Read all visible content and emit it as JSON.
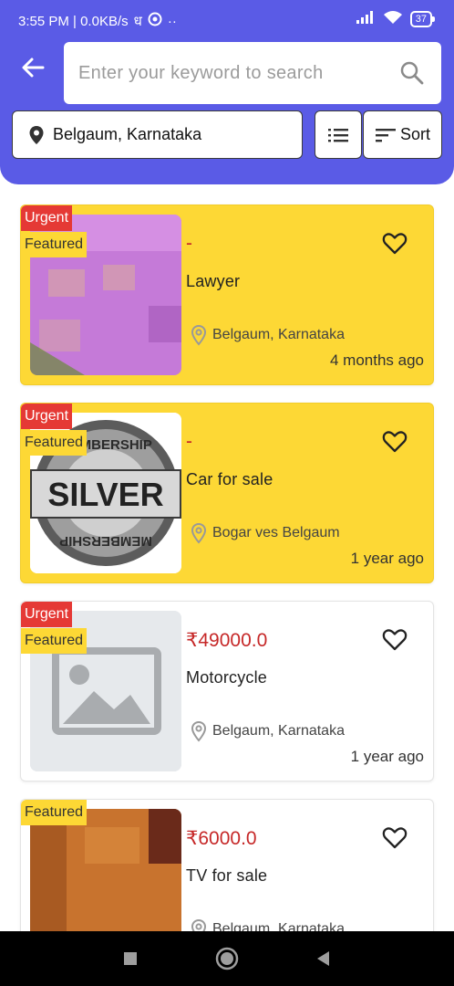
{
  "status_bar": {
    "time_net": "3:55 PM | 0.0KB/s",
    "extra": "ध",
    "dots": "··",
    "battery": "37"
  },
  "search": {
    "placeholder": "Enter your keyword to search",
    "value": ""
  },
  "location": {
    "label": "Belgaum, Karnataka"
  },
  "toolbar": {
    "sort_label": "Sort"
  },
  "listings": [
    {
      "urgent": "Urgent",
      "featured": "Featured",
      "price": "-",
      "title": "Lawyer",
      "location": "Belgaum, Karnataka",
      "time": "4 months ago",
      "highlight": true,
      "image": "purple-fabric"
    },
    {
      "urgent": "Urgent",
      "featured": "Featured",
      "price": "-",
      "title": "Car for sale",
      "location": "Bogar ves Belgaum",
      "time": "1 year ago",
      "highlight": true,
      "image": "silver-membership-seal",
      "image_text": {
        "top": "MEMBERSHIP",
        "middle": "SILVER",
        "bottom": "MEMBERSHIP"
      }
    },
    {
      "urgent": "Urgent",
      "featured": "Featured",
      "price": "₹49000.0",
      "title": "Motorcycle",
      "location": "Belgaum, Karnataka",
      "time": "1 year ago",
      "highlight": false,
      "image": "image-placeholder-icon"
    },
    {
      "featured": "Featured",
      "price": "₹6000.0",
      "title": "TV for sale",
      "location": "Belgaum, Karnataka",
      "highlight": false,
      "image": "orange-fabric"
    }
  ],
  "colors": {
    "header": "#5a5be6",
    "highlight_card": "#fdd835",
    "urgent": "#e53935",
    "price": "#c62828"
  },
  "nav": {
    "icons": [
      "square-icon",
      "circle-home-icon",
      "triangle-back-icon"
    ]
  }
}
